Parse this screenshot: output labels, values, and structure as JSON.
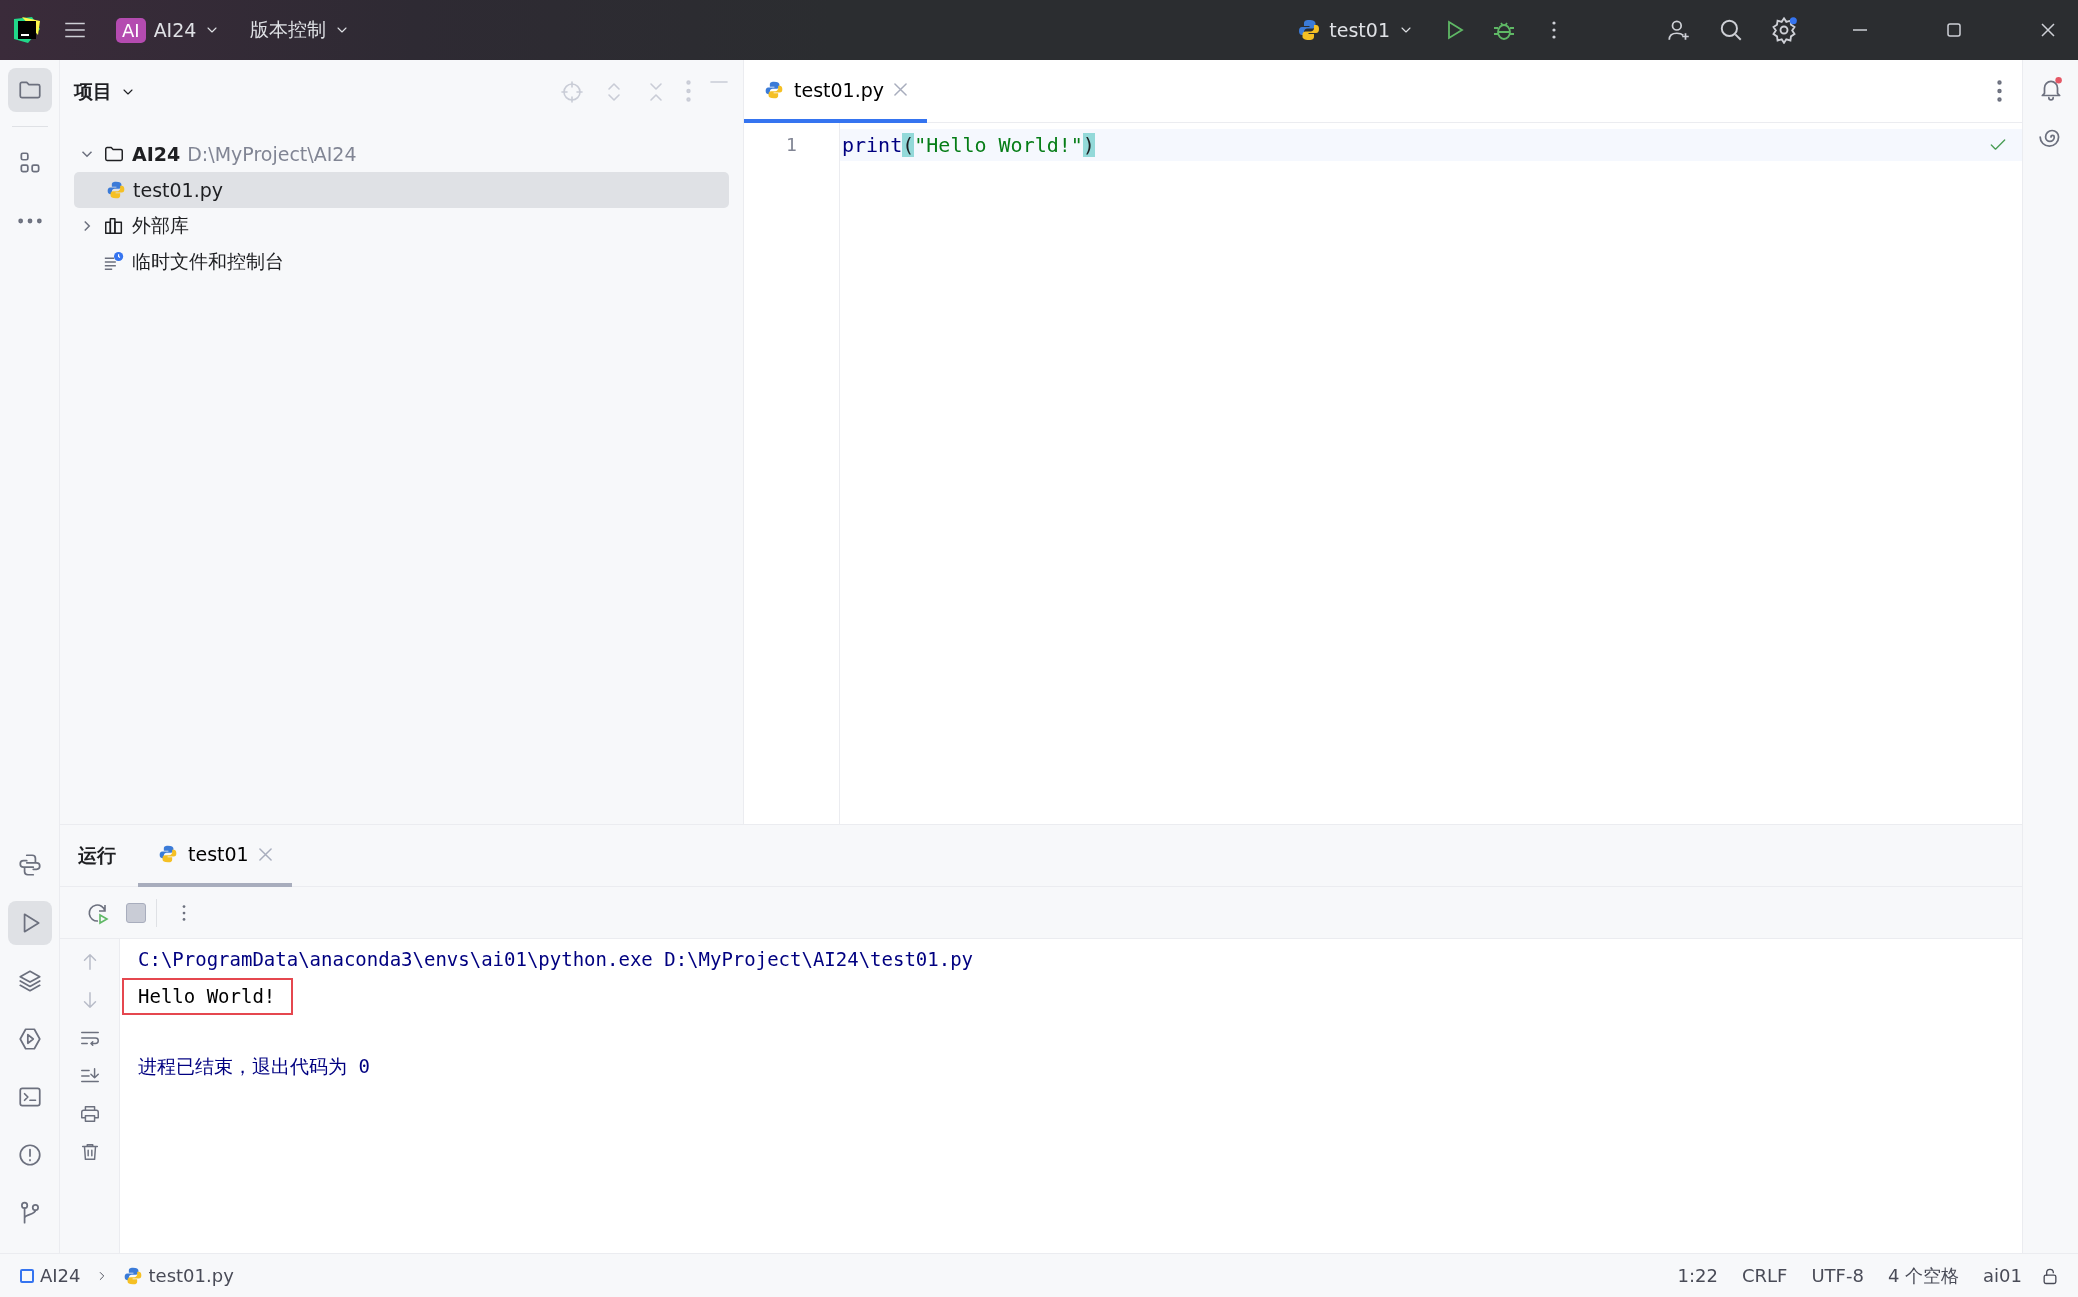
{
  "title_bar": {
    "project_badge": "AI",
    "project": "AI24",
    "vcs": "版本控制",
    "run_config": "test01"
  },
  "left_toolbar_top": [
    {
      "kind": "folder",
      "selected": true
    },
    {
      "kind": "structure",
      "selected": false
    },
    {
      "kind": "more",
      "selected": false
    }
  ],
  "left_toolbar_bottom": [
    {
      "kind": "python",
      "selected": false
    },
    {
      "kind": "run",
      "selected": true
    },
    {
      "kind": "layers",
      "selected": false
    },
    {
      "kind": "services",
      "selected": false
    },
    {
      "kind": "terminal",
      "selected": false
    },
    {
      "kind": "problems",
      "selected": false
    },
    {
      "kind": "git",
      "selected": false
    }
  ],
  "project_panel": {
    "title": "项目",
    "tree": [
      {
        "kind": "folder",
        "label": "AI24",
        "path": "D:\\MyProject\\AI24",
        "expanded": true,
        "selected": false,
        "children": [
          {
            "kind": "python",
            "label": "test01.py",
            "selected": true
          }
        ]
      },
      {
        "kind": "library",
        "label": "外部库",
        "expanded": false,
        "selected": false
      },
      {
        "kind": "scratch",
        "label": "临时文件和控制台",
        "selected": false
      }
    ]
  },
  "editor": {
    "tabs": [
      {
        "label": "test01.py",
        "selected": true
      }
    ],
    "lines": [
      {
        "number": "1",
        "tokens": [
          {
            "kind": "function",
            "text": "print"
          },
          {
            "kind": "paren",
            "text": "("
          },
          {
            "kind": "string",
            "text": "\"Hello World!\""
          },
          {
            "kind": "paren",
            "text": ")"
          }
        ]
      }
    ]
  },
  "run_panel": {
    "title": "运行",
    "tabs": [
      {
        "label": "test01",
        "selected": true
      }
    ],
    "output": [
      {
        "kind": "command",
        "text": "C:\\ProgramData\\anaconda3\\envs\\ai01\\python.exe D:\\MyProject\\AI24\\test01.py",
        "highlighted": false
      },
      {
        "kind": "stdout",
        "text": "Hello World!",
        "highlighted": true
      },
      {
        "kind": "system",
        "text": "进程已结束，退出代码为 0",
        "highlighted": false
      }
    ]
  },
  "status_bar": {
    "breadcrumbs": [
      "AI24",
      "test01.py"
    ],
    "items": [
      "1:22",
      "CRLF",
      "UTF-8",
      "4 个空格",
      "ai01"
    ]
  }
}
